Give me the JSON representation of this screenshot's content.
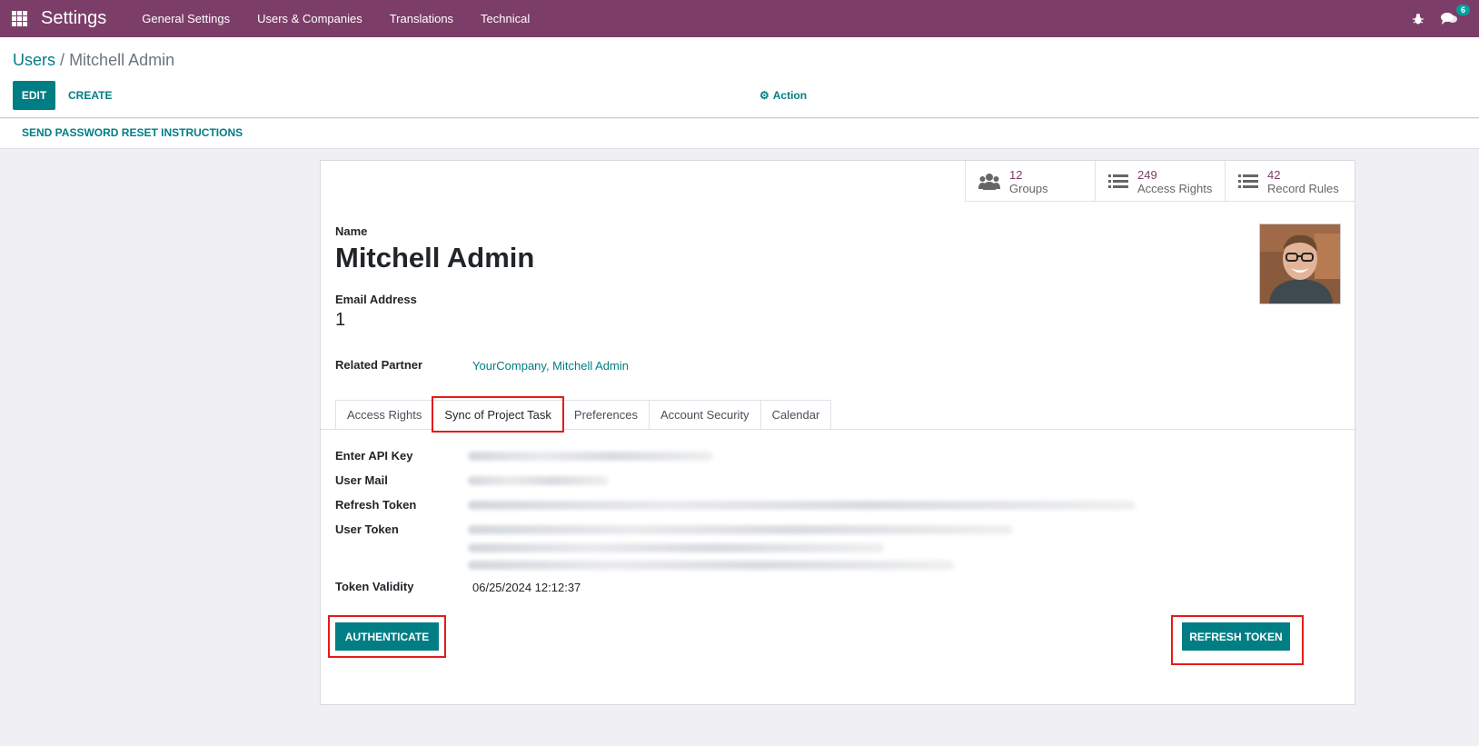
{
  "navbar": {
    "brand": "Settings",
    "menu": [
      "General Settings",
      "Users & Companies",
      "Translations",
      "Technical"
    ],
    "chat_badge": "6",
    "color": "#7c3e68"
  },
  "breadcrumb": {
    "parent": "Users",
    "separator": "/",
    "current": "Mitchell Admin"
  },
  "toolbar": {
    "edit_label": "EDIT",
    "create_label": "CREATE",
    "action_label": "Action"
  },
  "statusbar": {
    "reset_label": "SEND PASSWORD RESET INSTRUCTIONS"
  },
  "stat_buttons": [
    {
      "value": "12",
      "label": "Groups",
      "icon": "users-icon"
    },
    {
      "value": "249",
      "label": "Access Rights",
      "icon": "list-icon"
    },
    {
      "value": "42",
      "label": "Record Rules",
      "icon": "list-icon"
    }
  ],
  "form": {
    "name_label": "Name",
    "name_value": "Mitchell Admin",
    "email_label": "Email Address",
    "email_value": "1",
    "partner_label": "Related Partner",
    "partner_value": "YourCompany, Mitchell Admin"
  },
  "tabs": [
    "Access Rights",
    "Sync of Project Task",
    "Preferences",
    "Account Security",
    "Calendar"
  ],
  "active_tab": "Sync of Project Task",
  "sync_tab": {
    "api_key_label": "Enter API Key",
    "user_mail_label": "User Mail",
    "refresh_token_label": "Refresh Token",
    "user_token_label": "User Token",
    "token_validity_label": "Token Validity",
    "token_validity_value": "06/25/2024 12:12:37",
    "authenticate_label": "AUTHENTICATE",
    "refresh_token_button": "REFRESH TOKEN"
  },
  "colors": {
    "accent": "#017e84",
    "highlight": "#e31b1b",
    "stat_value": "#7c3e68"
  }
}
